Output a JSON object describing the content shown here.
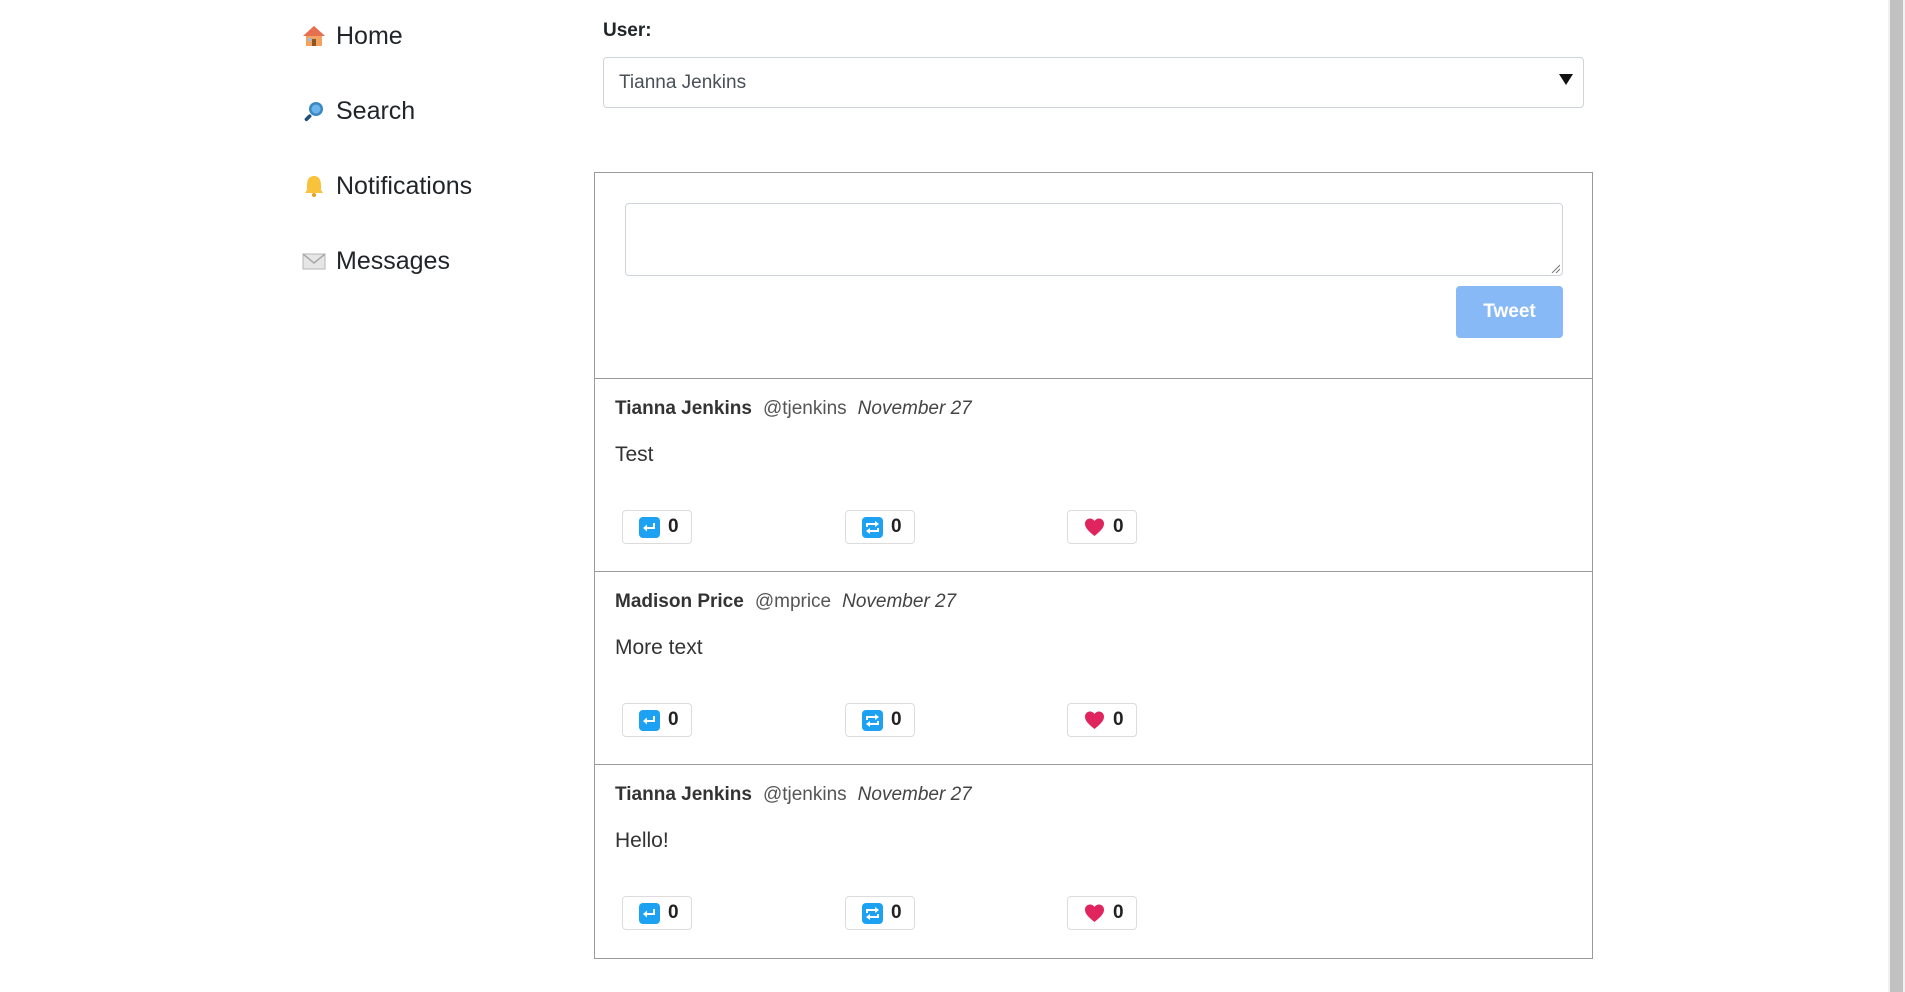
{
  "sidebar": {
    "items": [
      {
        "label": "Home",
        "icon": "house-icon"
      },
      {
        "label": "Search",
        "icon": "magnifier-icon"
      },
      {
        "label": "Notifications",
        "icon": "bell-icon"
      },
      {
        "label": "Messages",
        "icon": "envelope-icon"
      }
    ]
  },
  "user_select": {
    "label": "User:",
    "selected": "Tianna Jenkins"
  },
  "composer": {
    "textarea_value": "",
    "tweet_button": "Tweet",
    "button_color": "#88b9f7"
  },
  "tweets": [
    {
      "name": "Tianna Jenkins",
      "handle": "@tjenkins",
      "date": "November 27",
      "text": "Test",
      "reply_count": "0",
      "retweet_count": "0",
      "like_count": "0"
    },
    {
      "name": "Madison Price",
      "handle": "@mprice",
      "date": "November 27",
      "text": "More text",
      "reply_count": "0",
      "retweet_count": "0",
      "like_count": "0"
    },
    {
      "name": "Tianna Jenkins",
      "handle": "@tjenkins",
      "date": "November 27",
      "text": "Hello!",
      "reply_count": "0",
      "retweet_count": "0",
      "like_count": "0"
    }
  ],
  "colors": {
    "action_blue": "#1da1f2",
    "heart_red": "#e0245e"
  }
}
